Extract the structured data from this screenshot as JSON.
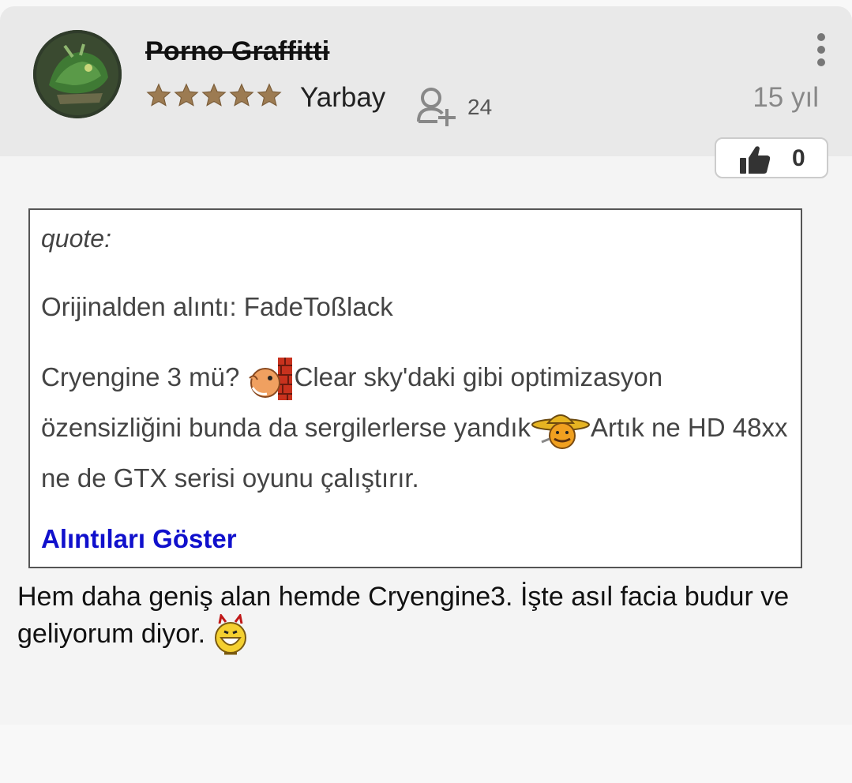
{
  "post": {
    "author": {
      "username": "Porno Graffitti",
      "rank": "Yarbay",
      "star_count": 5,
      "follower_count": "24"
    },
    "age": "15 yıl",
    "likes": "0"
  },
  "quote": {
    "label": "quote:",
    "source": "Orijinalden alıntı: FadeToßlack",
    "text_parts": [
      "Cryengine 3 mü? ",
      "Clear sky'daki gibi optimizasyon özensizliğini bunda da sergilerlerse yandık",
      "Artık ne HD 48xx ne de GTX serisi oyunu çalıştırır."
    ],
    "show_quotes_link": "Alıntıları Göster"
  },
  "body": {
    "text": "Hem daha geniş alan hemde Cryengine3. İşte asıl facia budur ve geliyorum diyor. "
  },
  "colors": {
    "link": "#1010cc",
    "star": "#9c7b52",
    "header_bg": "#e9e9e9"
  },
  "icons": [
    "avatar",
    "star-icon",
    "add-user-icon",
    "more-vertical-icon",
    "thumbs-up-icon",
    "emoticon-wall-hit",
    "emoticon-sombrero",
    "emoticon-devil-grin"
  ]
}
